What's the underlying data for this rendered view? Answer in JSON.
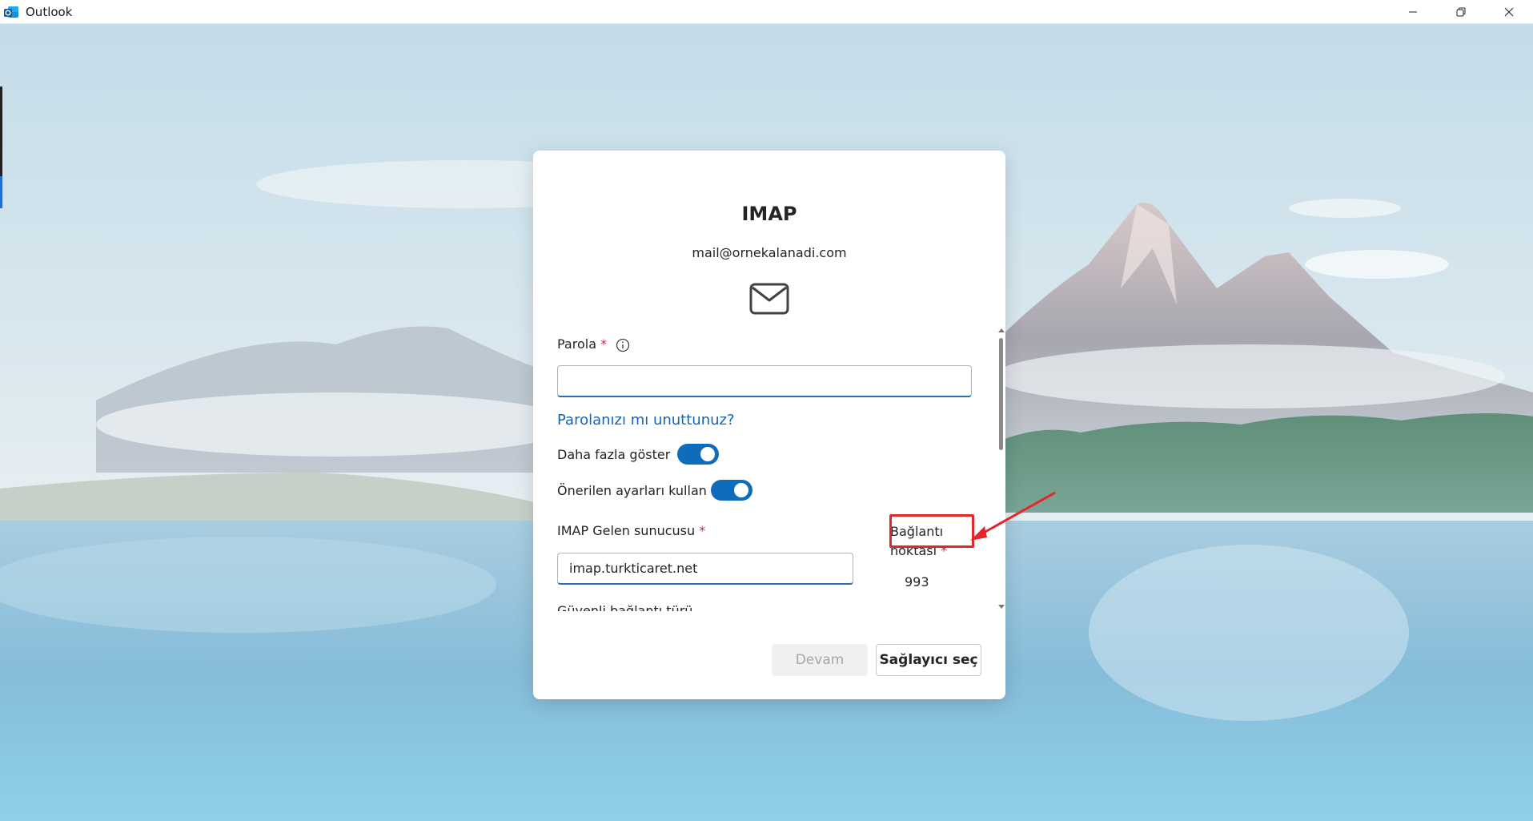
{
  "window": {
    "title": "Outlook"
  },
  "dialog": {
    "title": "IMAP",
    "email": "mail@ornekalanadi.com",
    "password": {
      "label": "Parola",
      "required_mark": "*",
      "value": ""
    },
    "forgot_password_link": "Parolanızı mı unuttunuz?",
    "show_more": {
      "label": "Daha fazla göster",
      "on": true
    },
    "use_recommended": {
      "label": "Önerilen ayarları kullan",
      "on": true
    },
    "imap_server": {
      "label": "IMAP Gelen sunucusu",
      "required_mark": "*",
      "value": "imap.turkticaret.net"
    },
    "port": {
      "label_line1": "Bağlantı",
      "label_line2": "noktası",
      "required_mark": "*",
      "value": "993"
    },
    "secure_connection": {
      "label": "Güvenli bağlantı türü"
    },
    "buttons": {
      "continue": "Devam",
      "choose_provider": "Sağlayıcı seç"
    }
  },
  "colors": {
    "accent": "#0f6cbd",
    "link": "#1564b8",
    "required": "#c4314b",
    "annotation": "#e3262a"
  },
  "icons": [
    "outlook-app-icon",
    "minimize-icon",
    "restore-icon",
    "close-icon",
    "mail-envelope-icon",
    "info-icon"
  ]
}
